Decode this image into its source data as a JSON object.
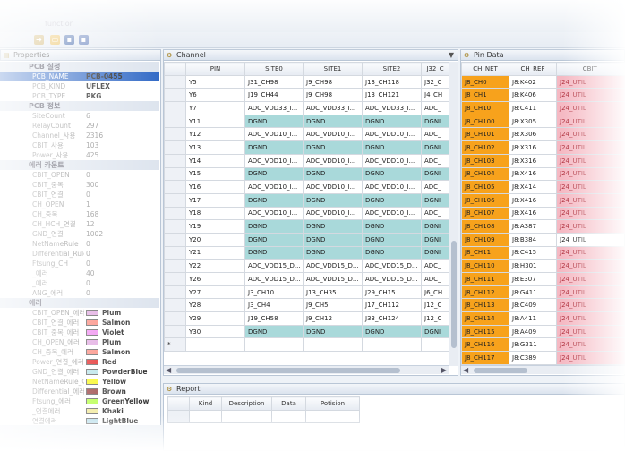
{
  "app": {
    "title": "function"
  },
  "colors": {
    "teal": "#a9d9da",
    "orange": "#f7a21c",
    "pink": "#f5b9c3"
  },
  "toolbar": {
    "icons": [
      "arrow-icon",
      "open-folder-icon",
      "save-icon",
      "save-all-icon"
    ]
  },
  "properties": {
    "title": "Properties",
    "sections": [
      {
        "category": "PCB 설정",
        "rows": [
          {
            "key": "PCB_NAME",
            "value": "PCB-0455",
            "selected": true
          },
          {
            "key": "PCB_KIND",
            "value": "UFLEX"
          },
          {
            "key": "PCB_TYPE",
            "value": "PKG"
          }
        ]
      },
      {
        "category": "PCB 정보",
        "rows": [
          {
            "key": "SiteCount",
            "value": "6",
            "light": true
          },
          {
            "key": "RelayCount",
            "value": "297",
            "light": true
          },
          {
            "key": "Channel_사용",
            "value": "2316",
            "light": true
          },
          {
            "key": "CBIT_사용",
            "value": "103",
            "light": true
          },
          {
            "key": "Power_사용",
            "value": "425",
            "light": true
          }
        ]
      },
      {
        "category": "에러 카운트",
        "rows": [
          {
            "key": "CBIT_OPEN",
            "value": "0",
            "light": true
          },
          {
            "key": "CBIT_중복",
            "value": "300",
            "light": true
          },
          {
            "key": "CBIT_연결",
            "value": "0",
            "light": true
          },
          {
            "key": "CH_OPEN",
            "value": "1",
            "light": true
          },
          {
            "key": "CH_중복",
            "value": "168",
            "light": true
          },
          {
            "key": "CH_HCH_연결",
            "value": "12",
            "light": true
          },
          {
            "key": "GND_연결",
            "value": "1002",
            "light": true
          },
          {
            "key": "NetNameRule",
            "value": "0",
            "light": true
          },
          {
            "key": "Differential_Rule",
            "value": "0",
            "light": true
          },
          {
            "key": "Ftsung_CH",
            "value": "0",
            "light": true
          },
          {
            "key": "_에러",
            "value": "40",
            "light": true
          },
          {
            "key": "_에러",
            "value": "0",
            "light": true
          },
          {
            "key": "ANG_에러",
            "value": "0",
            "light": true
          }
        ]
      },
      {
        "category": "에러",
        "colors": [
          {
            "key": "CBIT_OPEN_에러",
            "label": "Plum",
            "color": "#dda0dd"
          },
          {
            "key": "CBIT_연결_에러",
            "label": "Salmon",
            "color": "#fa8072"
          },
          {
            "key": "CBIT_중복_에러",
            "label": "Violet",
            "color": "#ee82ee"
          },
          {
            "key": "CH_OPEN_에러",
            "label": "Plum",
            "color": "#dda0dd"
          },
          {
            "key": "CH_중복_에러",
            "label": "Salmon",
            "color": "#fa8072"
          },
          {
            "key": "Power_연결_에러",
            "label": "Red",
            "color": "#e01010"
          },
          {
            "key": "GND_연결_에러",
            "label": "PowderBlue",
            "color": "#b0e0e6"
          },
          {
            "key": "NetNameRule_에러",
            "label": "Yellow",
            "color": "#f6f600"
          },
          {
            "key": "Differential_에러",
            "label": "Brown",
            "color": "#8b2a2a"
          },
          {
            "key": "Ftsung_에러",
            "label": "GreenYellow",
            "color": "#adff2f"
          },
          {
            "key": "_연결에러",
            "label": "Khaki",
            "color": "#f0e68c"
          },
          {
            "key": "연결에러",
            "label": "LightBlue",
            "color": "#add8e6"
          }
        ]
      }
    ]
  },
  "channel": {
    "title": "Channel",
    "columns": [
      "PIN",
      "SITE0",
      "SITE1",
      "SITE2",
      "J32_C"
    ],
    "rows": [
      {
        "pin": "Y5",
        "cells": [
          "J31_CH98",
          "J9_CH98",
          "J13_CH118",
          "J32_C"
        ]
      },
      {
        "pin": "Y6",
        "cells": [
          "J19_CH44",
          "J9_CH98",
          "J13_CH121",
          "J4_CH"
        ]
      },
      {
        "pin": "Y7",
        "cells": [
          "ADC_VDD33_I...",
          "ADC_VDD33_I...",
          "ADC_VDD33_I...",
          "ADC_"
        ]
      },
      {
        "pin": "Y11",
        "cells": [
          "DGND",
          "DGND",
          "DGND",
          "DGNI"
        ],
        "teal": true
      },
      {
        "pin": "Y12",
        "cells": [
          "ADC_VDD10_I...",
          "ADC_VDD10_I...",
          "ADC_VDD10_I...",
          "ADC_"
        ]
      },
      {
        "pin": "Y13",
        "cells": [
          "DGND",
          "DGND",
          "DGND",
          "DGNI"
        ],
        "teal": true
      },
      {
        "pin": "Y14",
        "cells": [
          "ADC_VDD10_I...",
          "ADC_VDD10_I...",
          "ADC_VDD10_I...",
          "ADC_"
        ]
      },
      {
        "pin": "Y15",
        "cells": [
          "DGND",
          "DGND",
          "DGND",
          "DGNI"
        ],
        "teal": true
      },
      {
        "pin": "Y16",
        "cells": [
          "ADC_VDD10_I...",
          "ADC_VDD10_I...",
          "ADC_VDD10_I...",
          "ADC_"
        ]
      },
      {
        "pin": "Y17",
        "cells": [
          "DGND",
          "DGND",
          "DGND",
          "DGNI"
        ],
        "teal": true
      },
      {
        "pin": "Y18",
        "cells": [
          "ADC_VDD10_I...",
          "ADC_VDD10_I...",
          "ADC_VDD10_I...",
          "ADC_"
        ]
      },
      {
        "pin": "Y19",
        "cells": [
          "DGND",
          "DGND",
          "DGND",
          "DGNI"
        ],
        "teal": true
      },
      {
        "pin": "Y20",
        "cells": [
          "DGND",
          "DGND",
          "DGND",
          "DGNI"
        ],
        "teal": true
      },
      {
        "pin": "Y21",
        "cells": [
          "DGND",
          "DGND",
          "DGND",
          "DGNI"
        ],
        "teal": true
      },
      {
        "pin": "Y22",
        "cells": [
          "ADC_VDD15_D...",
          "ADC_VDD15_D...",
          "ADC_VDD15_D...",
          "ADC_"
        ]
      },
      {
        "pin": "Y26",
        "cells": [
          "ADC_VDD15_D...",
          "ADC_VDD15_D...",
          "ADC_VDD15_D...",
          "ADC_"
        ]
      },
      {
        "pin": "Y27",
        "cells": [
          "J3_CH10",
          "J13_CH35",
          "J29_CH15",
          "J6_CH"
        ]
      },
      {
        "pin": "Y28",
        "cells": [
          "J3_CH4",
          "J9_CH5",
          "J17_CH112",
          "J12_C"
        ]
      },
      {
        "pin": "Y29",
        "cells": [
          "J19_CH58",
          "J9_CH12",
          "J33_CH124",
          "J12_C"
        ]
      },
      {
        "pin": "Y30",
        "cells": [
          "DGND",
          "DGND",
          "DGND",
          "DGNI"
        ],
        "teal": true
      }
    ],
    "new_row_marker": "*"
  },
  "pin_data": {
    "title": "Pin Data",
    "columns": [
      "CH_NET",
      "CH_REF",
      "CBIT_"
    ],
    "rows": [
      [
        "J8_CH0",
        "J8:K402",
        "J24_UTIL"
      ],
      [
        "J8_CH1",
        "J8:K406",
        "J24_UTIL"
      ],
      [
        "J8_CH10",
        "J8:C411",
        "J24_UTIL"
      ],
      [
        "J8_CH100",
        "J8:X305",
        "J24_UTIL"
      ],
      [
        "J8_CH101",
        "J8:X306",
        "J24_UTIL"
      ],
      [
        "J8_CH102",
        "J8:X316",
        "J24_UTIL"
      ],
      [
        "J8_CH103",
        "J8:X316",
        "J24_UTIL"
      ],
      [
        "J8_CH104",
        "J8:X416",
        "J24_UTIL"
      ],
      [
        "J8_CH105",
        "J8:X414",
        "J24_UTIL"
      ],
      [
        "J8_CH106",
        "J8:X416",
        "J24_UTIL"
      ],
      [
        "J8_CH107",
        "J8:X416",
        "J24_UTIL"
      ],
      [
        "J8_CH108",
        "J8:A387",
        "J24_UTIL"
      ],
      [
        "J8_CH109",
        "J8:B384",
        "J24_UTIL"
      ],
      [
        "J8_CH11",
        "J8:C415",
        "J24_UTIL"
      ],
      [
        "J8_CH110",
        "J8:H301",
        "J24_UTIL"
      ],
      [
        "J8_CH111",
        "J8:E307",
        "J24_UTIL"
      ],
      [
        "J8_CH112",
        "J8:G411",
        "J24_UTIL"
      ],
      [
        "J8_CH113",
        "J8:C409",
        "J24_UTIL"
      ],
      [
        "J8_CH114",
        "J8:A411",
        "J24_UTIL"
      ],
      [
        "J8_CH115",
        "J8:A409",
        "J24_UTIL"
      ],
      [
        "J8_CH116",
        "J8:G311",
        "J24_UTIL"
      ],
      [
        "J8_CH117",
        "J8:C389",
        "J24_UTIL"
      ]
    ],
    "pink_cells": [
      0,
      1,
      2,
      3,
      4,
      5,
      6,
      7,
      8,
      9,
      10,
      11,
      13,
      14,
      15,
      16,
      17,
      18,
      19,
      20,
      21
    ]
  },
  "report": {
    "title": "Report",
    "columns": [
      "Kind",
      "Description",
      "Data",
      "Potision"
    ]
  }
}
